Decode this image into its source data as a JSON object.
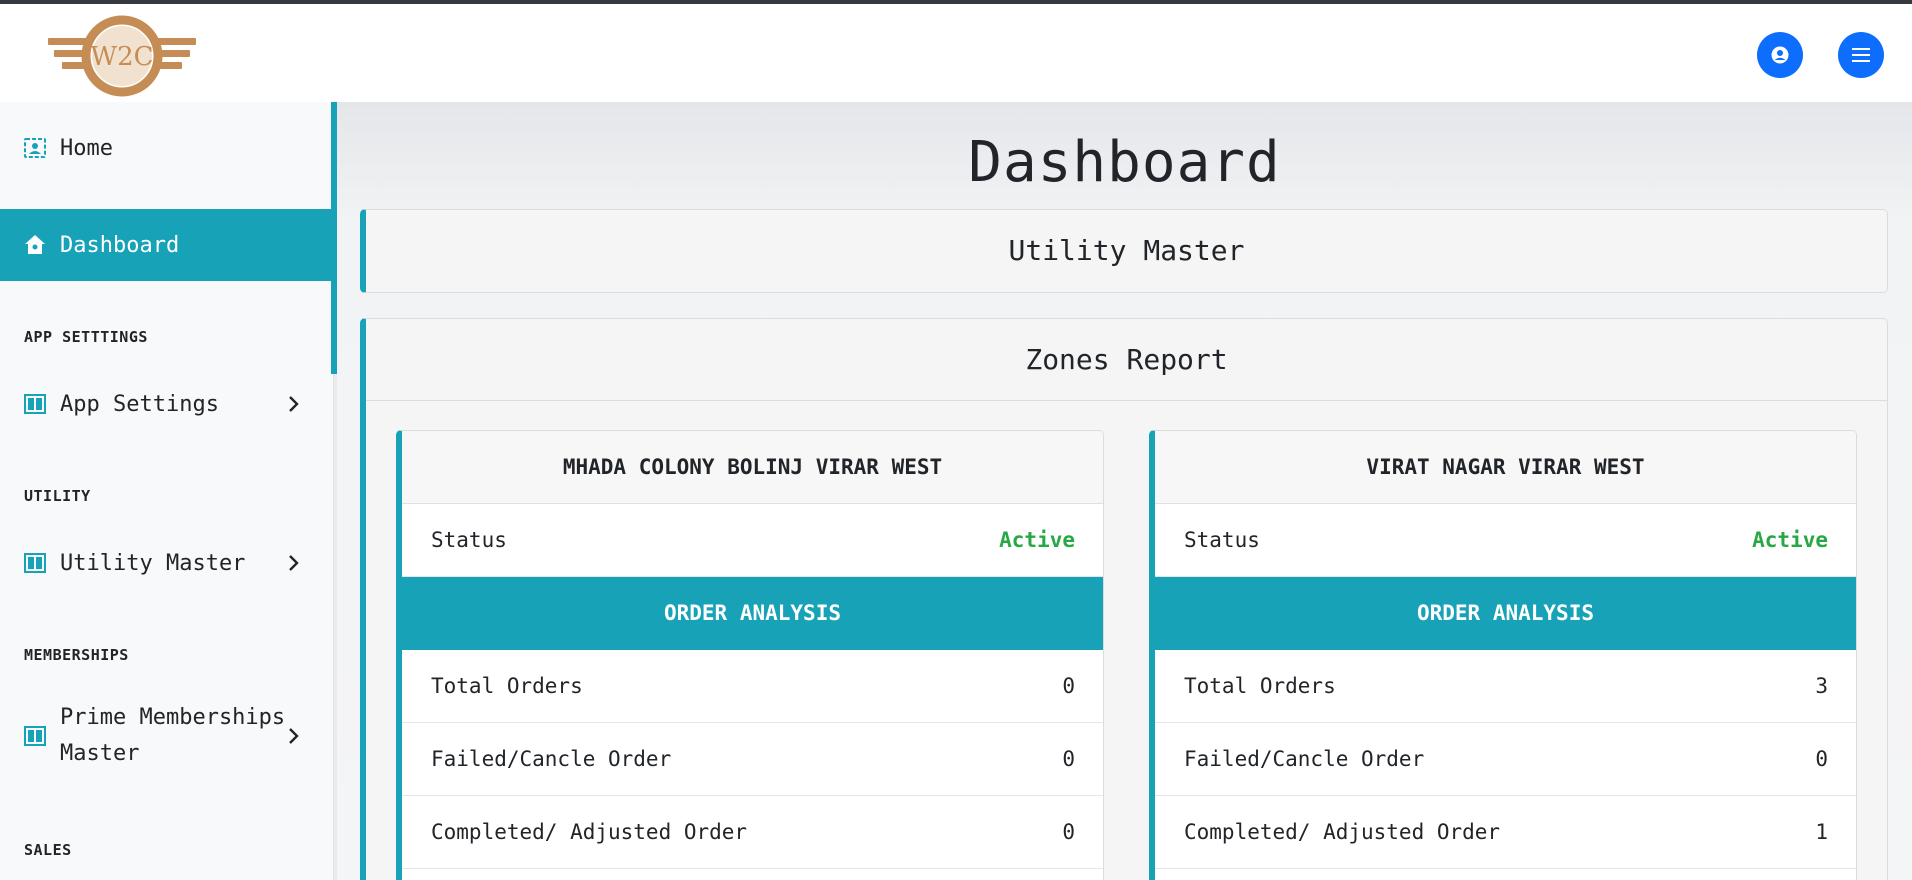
{
  "header": {
    "logo_text": "W2C",
    "user_icon": "user-circle-icon",
    "menu_icon": "hamburger-menu-icon",
    "accent_color": "#0d6efd"
  },
  "sidebar": {
    "home_label": "Home",
    "dashboard_label": "Dashboard",
    "sections": {
      "app_settings": "APP SETTTINGS",
      "utility": "UTILITY",
      "memberships": "MEMBERSHIPS",
      "sales": "SALES"
    },
    "items": {
      "app_settings": "App Settings",
      "utility_master": "Utility Master",
      "prime_line1": "Prime Memberships",
      "prime_line2": "Master"
    },
    "active_color": "#17a2b8"
  },
  "main": {
    "title": "Dashboard",
    "utility_panel_title": "Utility Master",
    "zones_panel_title": "Zones Report",
    "order_analysis_label": "ORDER ANALYSIS",
    "zones": [
      {
        "name": "MHADA COLONY BOLINJ VIRAR WEST",
        "status_label": "Status",
        "status": "Active",
        "total_orders_label": "Total Orders",
        "total_orders": "0",
        "failed_label": "Failed/Cancle Order",
        "failed": "0",
        "completed_label": "Completed/ Adjusted Order",
        "completed": "0"
      },
      {
        "name": "VIRAT NAGAR VIRAR WEST",
        "status_label": "Status",
        "status": "Active",
        "total_orders_label": "Total Orders",
        "total_orders": "3",
        "failed_label": "Failed/Cancle Order",
        "failed": "0",
        "completed_label": "Completed/ Adjusted Order",
        "completed": "1"
      }
    ],
    "status_color": "#28a745"
  }
}
